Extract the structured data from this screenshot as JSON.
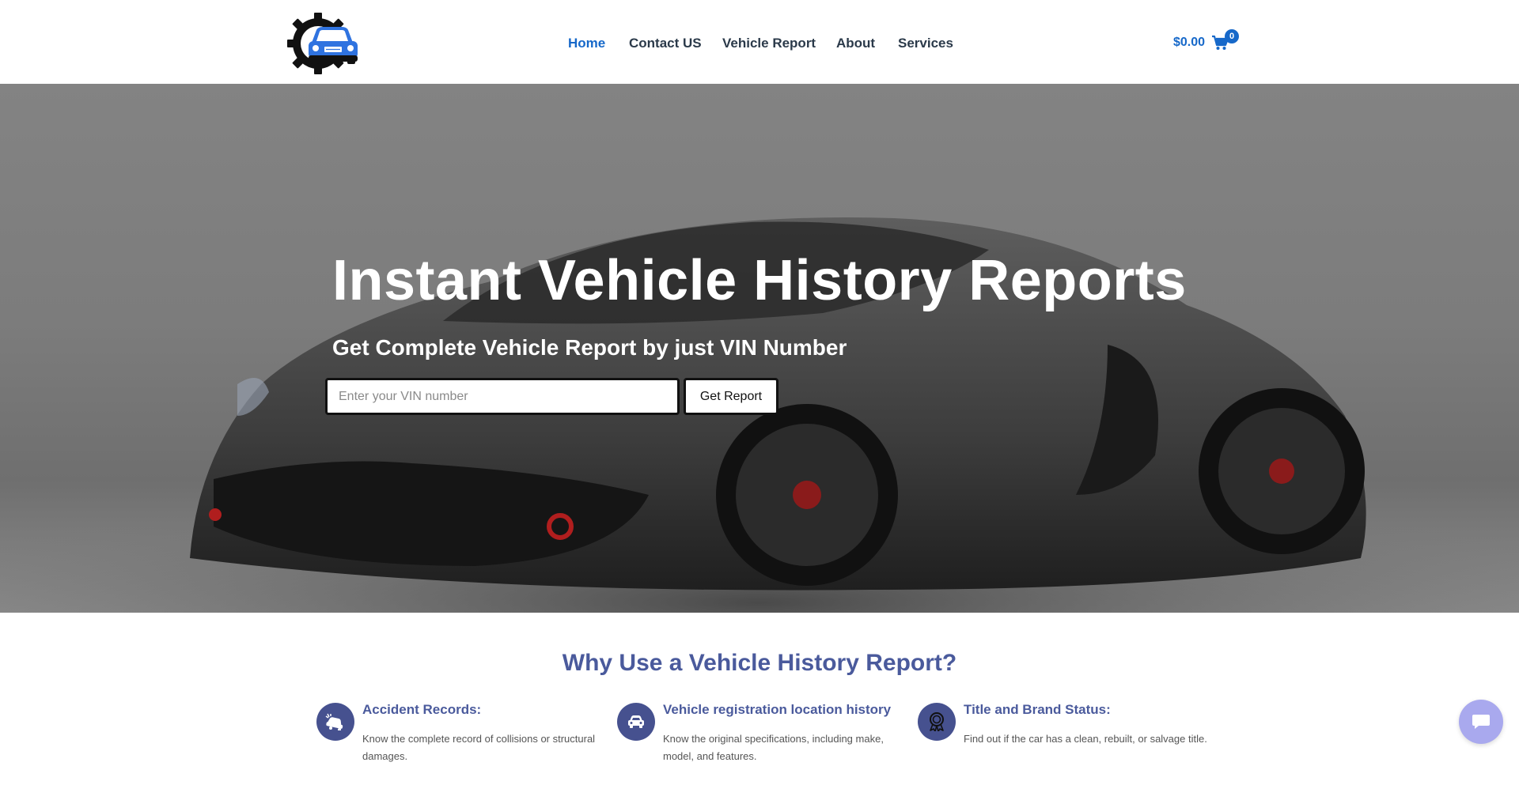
{
  "nav": {
    "items": [
      {
        "label": "Home",
        "active": true
      },
      {
        "label": "Contact US"
      },
      {
        "label": "Vehicle Report"
      },
      {
        "label": "About"
      },
      {
        "label": "Services"
      }
    ]
  },
  "cart": {
    "amount": "$0.00",
    "count": "0",
    "icon": "shopping-cart-icon"
  },
  "hero": {
    "title": "Instant Vehicle History Reports",
    "subtitle": "Get Complete Vehicle Report by just VIN Number",
    "vin_placeholder": "Enter your VIN number",
    "button_label": "Get Report"
  },
  "why": {
    "title": "Why Use a Vehicle History Report?",
    "features": [
      {
        "title": "Accident Records:",
        "description": "Know the complete record of collisions or structural damages.",
        "icon": "car-crash-icon"
      },
      {
        "title": "Vehicle registration location history",
        "description": "Know the original specifications, including make, model, and features.",
        "icon": "car-icon"
      },
      {
        "title": "Title and Brand Status:",
        "description": "Find out if the car has a clean, rebuilt, or salvage title.",
        "icon": "award-ribbon-icon"
      }
    ]
  },
  "colors": {
    "brand_blue": "#1668c9",
    "section_title": "#4a5a9c",
    "icon_circle": "#46518f",
    "chat_button": "#a9a9ee"
  },
  "chat": {
    "icon": "chat-bubble-icon"
  }
}
